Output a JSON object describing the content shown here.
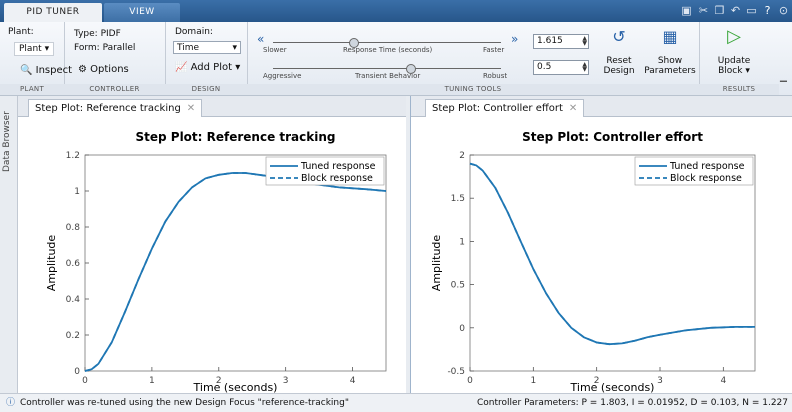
{
  "tabs": {
    "active": "PID TUNER",
    "inactive": "VIEW"
  },
  "plant": {
    "label": "Plant:",
    "value": "Plant",
    "inspect": "Inspect"
  },
  "controller": {
    "type": "Type: PIDF",
    "form": "Form: Parallel",
    "options": "Options"
  },
  "design": {
    "domain_label": "Domain:",
    "domain_value": "Time",
    "add_plot": "Add Plot"
  },
  "tuning": {
    "slower": "Slower",
    "response_time": "Response Time (seconds)",
    "faster": "Faster",
    "aggressive": "Aggressive",
    "transient": "Transient Behavior",
    "robust": "Robust",
    "response_value": "1.615",
    "transient_value": "0.5",
    "reset_1": "Reset",
    "reset_2": "Design",
    "show_1": "Show",
    "show_2": "Parameters",
    "response_level": 0.35,
    "transient_level": 0.6
  },
  "results": {
    "update_1": "Update",
    "update_2": "Block"
  },
  "section_labels": {
    "plant": "PLANT",
    "controller": "CONTROLLER",
    "design": "DESIGN",
    "tuning": "TUNING TOOLS",
    "results": "RESULTS"
  },
  "side": {
    "data_browser": "Data Browser"
  },
  "left_tab": "Step Plot: Reference tracking",
  "right_tab": "Step Plot: Controller effort",
  "status": {
    "left": "Controller was re-tuned using the new Design Focus \"reference-tracking\"",
    "right": "Controller Parameters: P = 1.803, I = 0.01952, D = 0.103, N = 1.227"
  },
  "chart_data": [
    {
      "type": "line",
      "title": "Step Plot: Reference tracking",
      "xlabel": "Time (seconds)",
      "ylabel": "Amplitude",
      "xlim": [
        0,
        4.5
      ],
      "ylim": [
        0,
        1.2
      ],
      "xticks": [
        0,
        1,
        2,
        3,
        4
      ],
      "yticks": [
        0,
        0.2,
        0.4,
        0.6,
        0.8,
        1,
        1.2
      ],
      "legend": "top-right",
      "series": [
        {
          "name": "Tuned response",
          "style": "solid",
          "color": "#1f77b4",
          "x": [
            0,
            0.1,
            0.2,
            0.4,
            0.6,
            0.8,
            1.0,
            1.2,
            1.4,
            1.6,
            1.8,
            2.0,
            2.2,
            2.4,
            2.6,
            2.8,
            3.0,
            3.4,
            3.8,
            4.2,
            4.5
          ],
          "y": [
            0,
            0.01,
            0.04,
            0.16,
            0.33,
            0.51,
            0.68,
            0.83,
            0.94,
            1.02,
            1.07,
            1.09,
            1.1,
            1.1,
            1.09,
            1.08,
            1.07,
            1.04,
            1.02,
            1.01,
            1.0
          ]
        },
        {
          "name": "Block response",
          "style": "dashed",
          "color": "#1f77b4",
          "x": [
            0,
            0.1,
            0.2,
            0.4,
            0.6,
            0.8,
            1.0,
            1.2,
            1.4,
            1.6,
            1.8,
            2.0,
            2.2,
            2.4,
            2.6,
            2.8,
            3.0,
            3.4,
            3.8,
            4.2,
            4.5
          ],
          "y": [
            0,
            0.01,
            0.04,
            0.16,
            0.33,
            0.51,
            0.68,
            0.83,
            0.94,
            1.02,
            1.07,
            1.09,
            1.1,
            1.1,
            1.09,
            1.08,
            1.07,
            1.04,
            1.02,
            1.01,
            1.0
          ]
        }
      ]
    },
    {
      "type": "line",
      "title": "Step Plot: Controller effort",
      "xlabel": "Time (seconds)",
      "ylabel": "Amplitude",
      "xlim": [
        0,
        4.5
      ],
      "ylim": [
        -0.5,
        2
      ],
      "xticks": [
        0,
        1,
        2,
        3,
        4
      ],
      "yticks": [
        -0.5,
        0,
        0.5,
        1,
        1.5,
        2
      ],
      "legend": "top-right",
      "series": [
        {
          "name": "Tuned response",
          "style": "solid",
          "color": "#1f77b4",
          "x": [
            0,
            0.1,
            0.2,
            0.4,
            0.6,
            0.8,
            1.0,
            1.2,
            1.4,
            1.6,
            1.8,
            2.0,
            2.2,
            2.4,
            2.6,
            2.8,
            3.0,
            3.4,
            3.8,
            4.2,
            4.5
          ],
          "y": [
            1.9,
            1.88,
            1.82,
            1.62,
            1.33,
            1.0,
            0.68,
            0.4,
            0.17,
            0.0,
            -0.11,
            -0.17,
            -0.19,
            -0.18,
            -0.15,
            -0.11,
            -0.08,
            -0.03,
            0.0,
            0.01,
            0.01
          ]
        },
        {
          "name": "Block response",
          "style": "dashed",
          "color": "#1f77b4",
          "x": [
            0,
            0.1,
            0.2,
            0.4,
            0.6,
            0.8,
            1.0,
            1.2,
            1.4,
            1.6,
            1.8,
            2.0,
            2.2,
            2.4,
            2.6,
            2.8,
            3.0,
            3.4,
            3.8,
            4.2,
            4.5
          ],
          "y": [
            1.9,
            1.88,
            1.82,
            1.62,
            1.33,
            1.0,
            0.68,
            0.4,
            0.17,
            0.0,
            -0.11,
            -0.17,
            -0.19,
            -0.18,
            -0.15,
            -0.11,
            -0.08,
            -0.03,
            0.0,
            0.01,
            0.01
          ]
        }
      ]
    }
  ]
}
